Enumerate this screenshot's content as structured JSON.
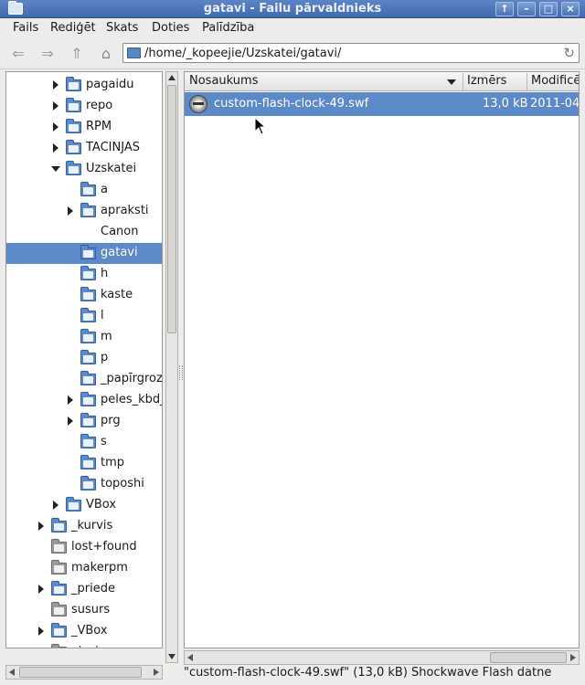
{
  "window": {
    "title": "gatavi - Failu pārvaldnieks"
  },
  "menubar": {
    "items": [
      "Fails",
      "Rediģēt",
      "Skats",
      "Doties",
      "Palīdzība"
    ]
  },
  "address": {
    "path": "/home/_kopeejie/Uzskatei/gatavi/"
  },
  "tree": {
    "items": [
      {
        "label": "pagaidu"
      },
      {
        "label": "repo"
      },
      {
        "label": "RPM"
      },
      {
        "label": "TACINJAS"
      },
      {
        "label": "Uzskatei"
      },
      {
        "label": "a"
      },
      {
        "label": "apraksti"
      },
      {
        "label": "Canon"
      },
      {
        "label": "gatavi"
      },
      {
        "label": "h"
      },
      {
        "label": "kaste"
      },
      {
        "label": "l"
      },
      {
        "label": "m"
      },
      {
        "label": "p"
      },
      {
        "label": "_papīrgroz"
      },
      {
        "label": "peles_kbd_"
      },
      {
        "label": "prg"
      },
      {
        "label": "s"
      },
      {
        "label": "tmp"
      },
      {
        "label": "toposhi"
      },
      {
        "label": "VBox"
      },
      {
        "label": "_kurvis"
      },
      {
        "label": "lost+found"
      },
      {
        "label": "makerpm"
      },
      {
        "label": "_priede"
      },
      {
        "label": "susurs"
      },
      {
        "label": "_VBox"
      },
      {
        "label": "viesis"
      }
    ]
  },
  "list": {
    "columns": {
      "name": "Nosaukums",
      "size": "Izmērs",
      "modified": "Modificē"
    },
    "files": [
      {
        "name": "custom-flash-clock-49.swf",
        "size": "13,0 kB",
        "modified": "2011-04-"
      }
    ]
  },
  "status": {
    "text": "\"custom-flash-clock-49.swf\" (13,0 kB) Shockwave Flash datne"
  }
}
